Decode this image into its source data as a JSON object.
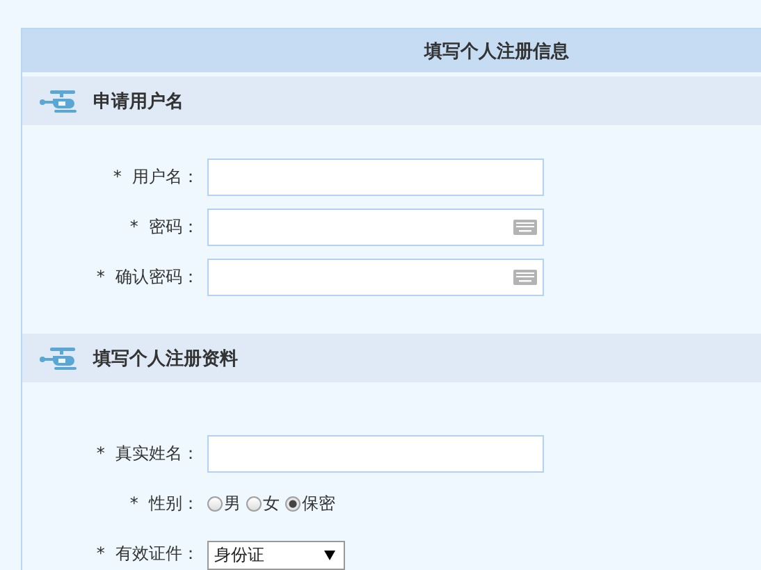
{
  "title": "填写个人注册信息",
  "sections": [
    {
      "heading": "申请用户名",
      "fields": [
        {
          "kind": "text",
          "label": "*  用户名："
        },
        {
          "kind": "password",
          "label": "*  密码："
        },
        {
          "kind": "password",
          "label": "*  确认密码："
        }
      ]
    },
    {
      "heading": "填写个人注册资料",
      "fields": [
        {
          "kind": "text",
          "label": "*  真实姓名："
        },
        {
          "kind": "radio",
          "label": "*  性别：",
          "options": [
            {
              "label": "男",
              "selected": false
            },
            {
              "label": "女",
              "selected": false
            },
            {
              "label": "保密",
              "selected": true
            }
          ]
        },
        {
          "kind": "select",
          "label": "*  有效证件：",
          "value": "身份证"
        }
      ]
    }
  ]
}
